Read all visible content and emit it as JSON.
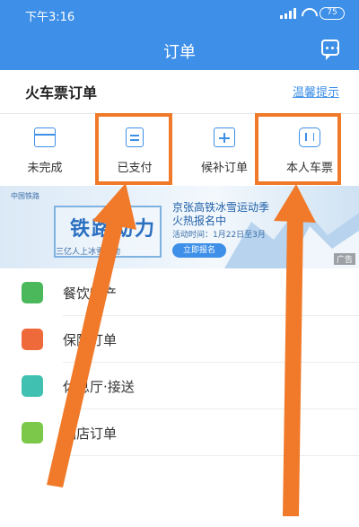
{
  "status_bar": {
    "time": "下午3:16",
    "battery": "75"
  },
  "nav": {
    "title": "订单",
    "message_icon": "message-icon"
  },
  "train": {
    "title": "火车票订单",
    "tip": "温馨提示",
    "items": [
      {
        "label": "未完成",
        "icon": "card-icon"
      },
      {
        "label": "已支付",
        "icon": "receipt-icon"
      },
      {
        "label": "候补订单",
        "icon": "calendar-plus-icon"
      },
      {
        "label": "本人车票",
        "icon": "luggage-icon"
      }
    ]
  },
  "banner": {
    "logo": "中国铁路",
    "big_text": "铁路动力",
    "small_text": "三亿人上冰雪运动",
    "title_line1": "京张高铁冰雪运动季",
    "title_line2": "火热报名中",
    "time": "活动时间：1月22日至3月",
    "button": "立即报名",
    "ad": "广告"
  },
  "list": [
    {
      "label": "餐饮特产",
      "icon": "food-icon",
      "color": "#4cb85c"
    },
    {
      "label": "保险订单",
      "icon": "shield-icon",
      "color": "#ef6a3a"
    },
    {
      "label": "休息厅·接送",
      "icon": "lounge-icon",
      "color": "#3fc0b0"
    },
    {
      "label": "酒店订单",
      "icon": "hotel-icon",
      "color": "#7cc84a"
    }
  ],
  "colors": {
    "primary": "#3d8fe8",
    "highlight": "#f07a2a"
  }
}
